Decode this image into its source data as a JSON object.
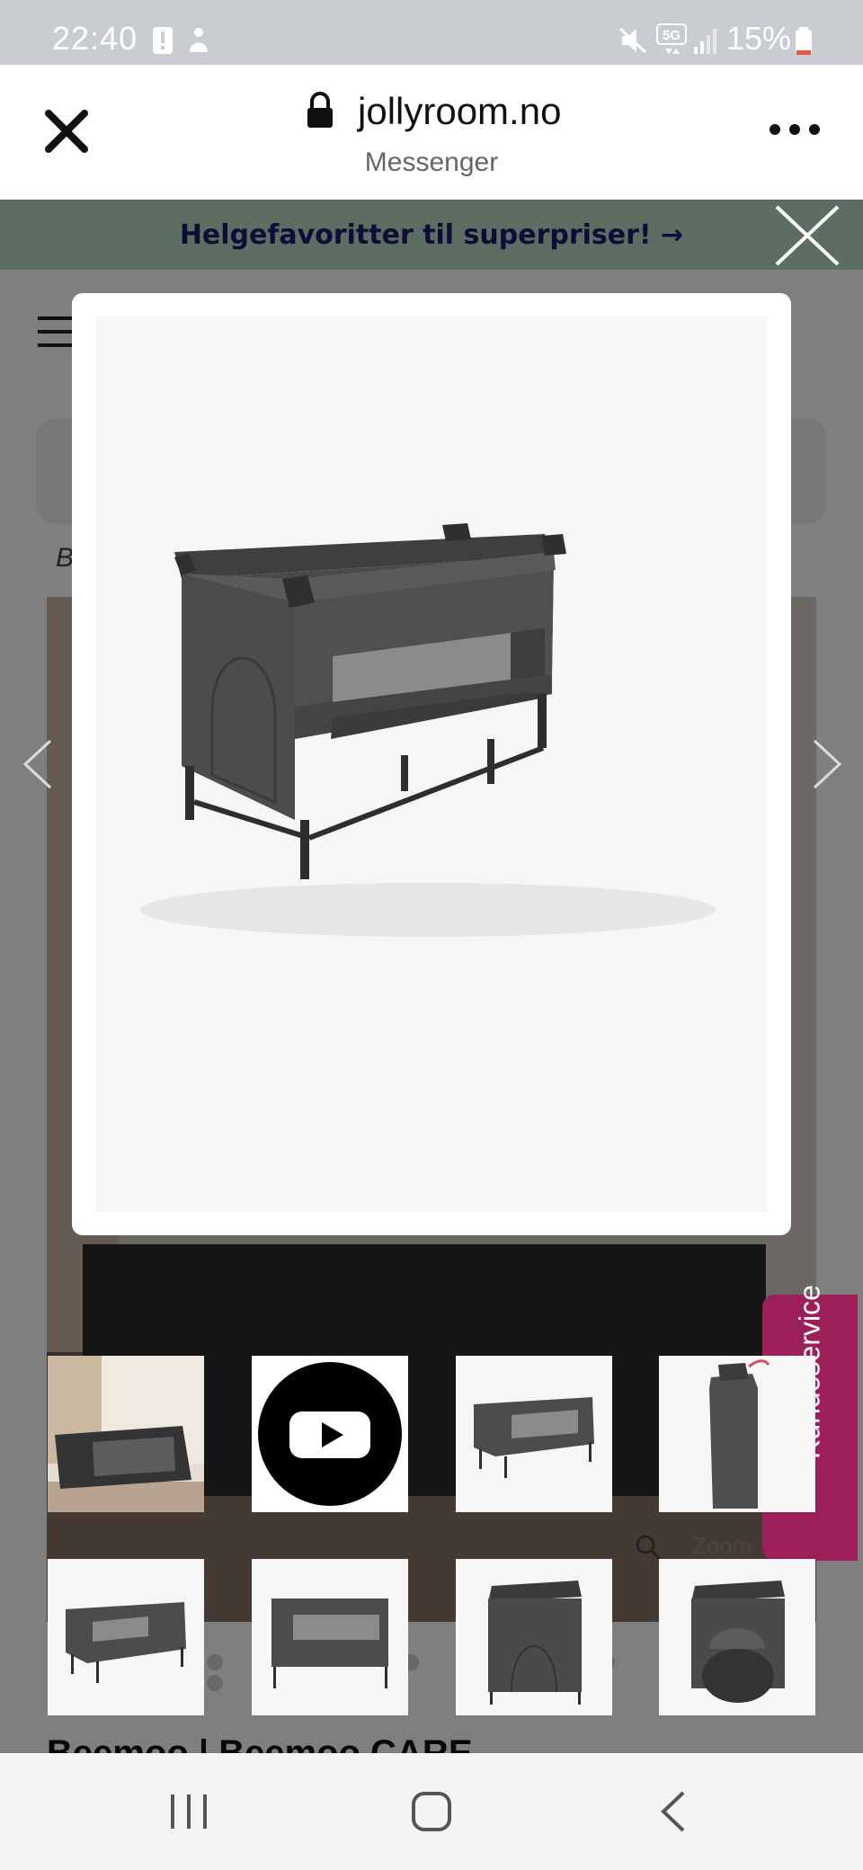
{
  "status_bar": {
    "time": "22:40",
    "battery": "15%",
    "network": "5G",
    "icons": [
      "alert-icon",
      "accessibility-icon",
      "mute-icon",
      "network-5g-icon",
      "signal-icon",
      "battery-icon"
    ]
  },
  "browser": {
    "domain": "jollyroom.no",
    "subtitle": "Messenger",
    "close_icon": "close-icon",
    "more_icon": "more-icon",
    "lock_icon": "lock-icon"
  },
  "promo": {
    "text": "Helgefavoritter til superpriser! →",
    "background": "#b7dcc3",
    "text_color": "#1a1a6e"
  },
  "page": {
    "breadcrumb_first_letter": "B",
    "product_title": "Beemoo | Beemoo CARE",
    "zoom_hint": "Zoom",
    "kundeservice": "Kundeservice",
    "kundeservice_color": "#9c1f5a"
  },
  "modal": {
    "image_description_icon": "travel-cot-image"
  },
  "thumbnails": [
    {
      "name": "thumbnail-travel-cot-room"
    },
    {
      "name": "thumbnail-video",
      "icon": "youtube-play-icon"
    },
    {
      "name": "thumbnail-travel-cot-angle"
    },
    {
      "name": "thumbnail-travel-cot-folded"
    },
    {
      "name": "thumbnail-travel-cot-side"
    },
    {
      "name": "thumbnail-travel-cot-front"
    },
    {
      "name": "thumbnail-travel-cot-end"
    },
    {
      "name": "thumbnail-travel-cot-open-end"
    }
  ],
  "nav_bar": {
    "recents_icon": "recents-icon",
    "home_icon": "home-icon",
    "back_icon": "back-icon"
  }
}
